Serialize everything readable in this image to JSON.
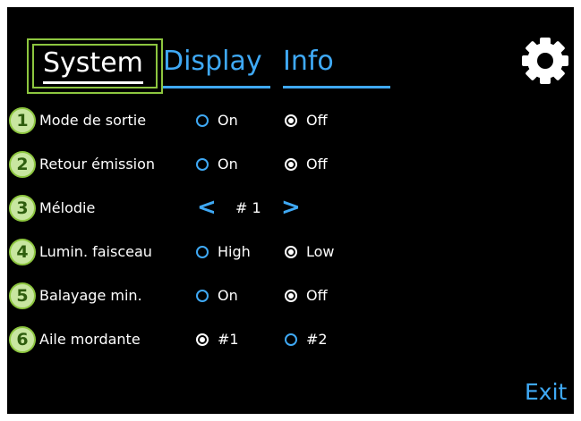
{
  "tabs": {
    "system": "System",
    "display": "Display",
    "info": "Info"
  },
  "settings_icon": "gear-icon",
  "rows": [
    {
      "num": "1",
      "label": "Mode de sortie",
      "opt1": "On",
      "opt2": "Off",
      "selected": "Off"
    },
    {
      "num": "2",
      "label": "Retour émission",
      "opt1": "On",
      "opt2": "Off",
      "selected": "Off"
    },
    {
      "num": "3",
      "label": "Mélodie",
      "prev": "<",
      "value": "# 1",
      "next": ">"
    },
    {
      "num": "4",
      "label": "Lumin. faisceau",
      "opt1": "High",
      "opt2": "Low",
      "selected": "Low"
    },
    {
      "num": "5",
      "label": "Balayage min.",
      "opt1": "On",
      "opt2": "Off",
      "selected": "Off"
    },
    {
      "num": "6",
      "label": "Aile mordante",
      "opt1": "#1",
      "opt2": "#2",
      "selected": "#1"
    }
  ],
  "exit_label": "Exit",
  "colors": {
    "accent_blue": "#3fa9f5",
    "highlight_green": "#8dc63f",
    "background": "#000000",
    "text": "#ffffff"
  }
}
